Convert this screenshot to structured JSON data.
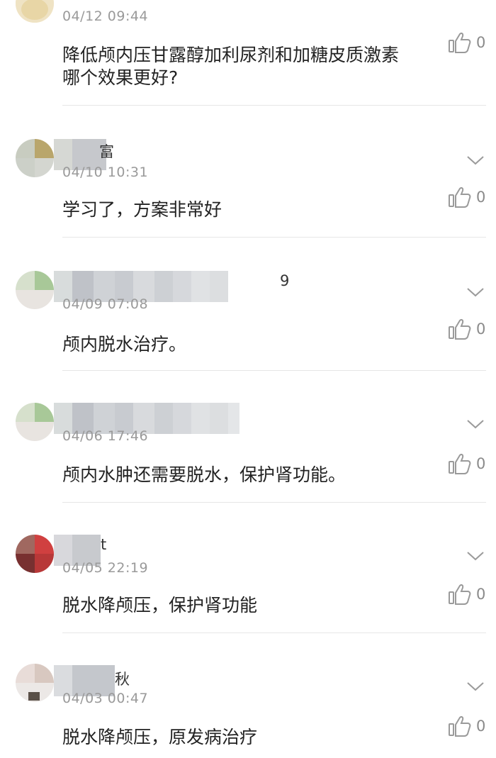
{
  "comments": [
    {
      "date": "04/12 09:44",
      "text_line1": "降低颅内压甘露醇加利尿剂和加糖皮质激素",
      "text_line2": "哪个效果更好?",
      "likes": "0"
    },
    {
      "name_tail": "富",
      "date": "04/10 10:31",
      "text": "学习了，方案非常好",
      "likes": "0"
    },
    {
      "name_tail": "9",
      "date": "04/09 07:08",
      "text": "颅内脱水治疗。",
      "likes": "0"
    },
    {
      "date": "04/06 17:46",
      "text": "颅内水肿还需要脱水，保护肾功能。",
      "likes": "0"
    },
    {
      "name_tail": "t",
      "date": "04/05 22:19",
      "text": "脱水降颅压，保护肾功能",
      "likes": "0"
    },
    {
      "name_tail": "秋",
      "date": "04/03 00:47",
      "text": "脱水降颅压，原发病治疗",
      "likes": "0"
    }
  ],
  "icons": {
    "like": "thumbs-up-icon",
    "expand": "chevron-down-icon"
  },
  "colors": {
    "text": "#222222",
    "meta": "#9a9a9a",
    "divider": "#e6e6e6",
    "icon": "#9a9a9a"
  }
}
